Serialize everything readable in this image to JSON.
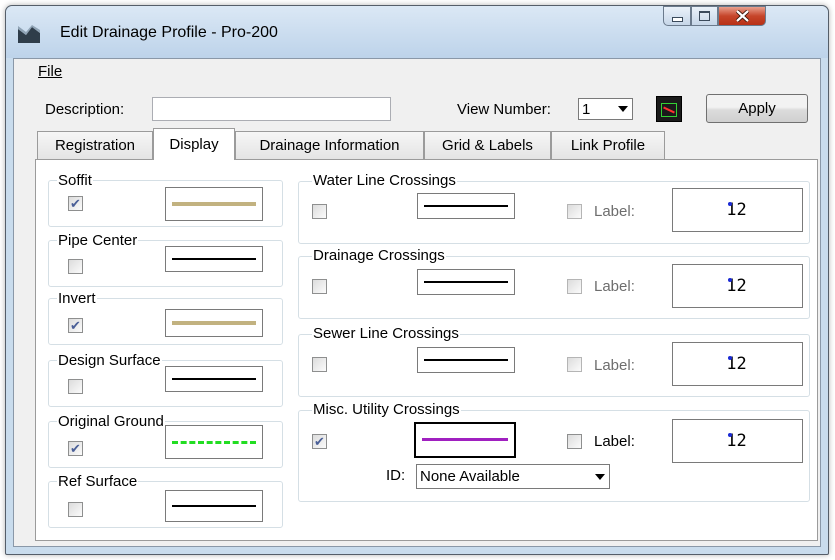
{
  "window": {
    "title": "Edit Drainage Profile - Pro-200",
    "controls": [
      "minimize-icon",
      "maximize-icon",
      "close-icon"
    ]
  },
  "menu": {
    "file": "File"
  },
  "toolbar": {
    "description_label": "Description:",
    "description_value": "",
    "view_number_label": "View Number:",
    "view_number_value": "1",
    "apply_label": "Apply"
  },
  "tabs": [
    {
      "label": "Registration",
      "active": false
    },
    {
      "label": "Display",
      "active": true
    },
    {
      "label": "Drainage Information",
      "active": false
    },
    {
      "label": "Grid & Labels",
      "active": false
    },
    {
      "label": "Link Profile",
      "active": false
    }
  ],
  "left_groups": [
    {
      "label": "Soffit",
      "checked": true,
      "line_style": "solid",
      "line_color": "#c2b280"
    },
    {
      "label": "Pipe Center",
      "checked": false,
      "line_style": "solid",
      "line_color": "#000000"
    },
    {
      "label": "Invert",
      "checked": true,
      "line_style": "solid",
      "line_color": "#c2b280"
    },
    {
      "label": "Design Surface",
      "checked": false,
      "line_style": "solid",
      "line_color": "#000000"
    },
    {
      "label": "Original Ground",
      "checked": true,
      "line_style": "dashed",
      "line_color": "#22dd22"
    },
    {
      "label": "Ref Surface",
      "checked": false,
      "line_style": "solid",
      "line_color": "#000000"
    }
  ],
  "right_groups": [
    {
      "label": "Water Line Crossings",
      "checked": false,
      "line_color": "#000000",
      "label_text": "Label:",
      "label_checked": false,
      "text_style": "12"
    },
    {
      "label": "Drainage Crossings",
      "checked": false,
      "line_color": "#000000",
      "label_text": "Label:",
      "label_checked": false,
      "text_style": "12"
    },
    {
      "label": "Sewer Line Crossings",
      "checked": false,
      "line_color": "#000000",
      "label_text": "Label:",
      "label_checked": false,
      "text_style": "12"
    },
    {
      "label": "Misc. Utility Crossings",
      "checked": true,
      "line_color": "#a020c0",
      "label_text": "Label:",
      "label_checked": false,
      "text_style": "12"
    }
  ],
  "misc": {
    "id_label": "ID:",
    "id_value": "None Available"
  }
}
